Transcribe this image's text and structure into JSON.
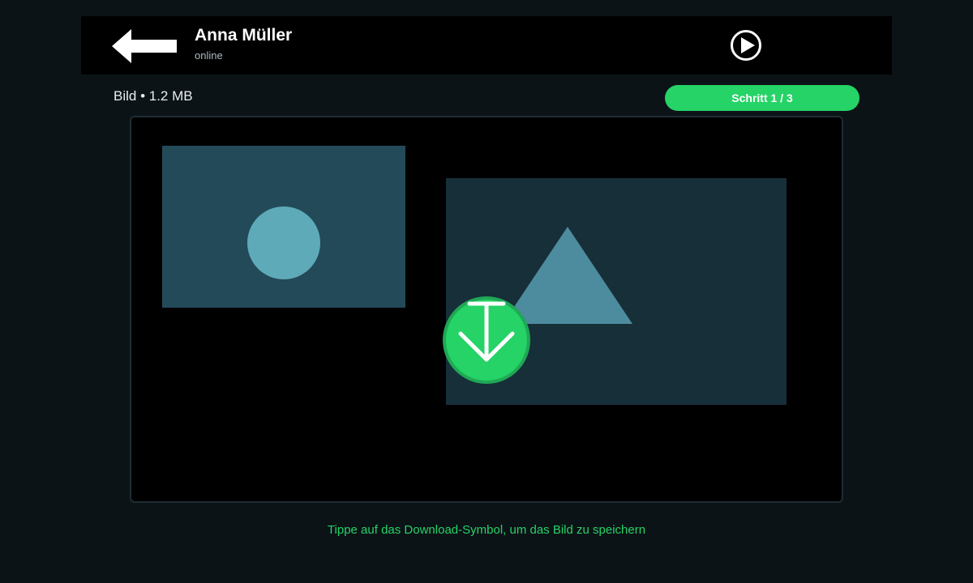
{
  "header": {
    "contact_name": "Anna Müller",
    "contact_status": "online",
    "back_icon": "arrow-left-icon",
    "play_icon": "play-circle-icon"
  },
  "media": {
    "file_info": "Bild • 1.2 MB",
    "step_label": "Schritt 1 / 3",
    "download_icon": "download-icon"
  },
  "hint": "Tippe auf das Download-Symbol, um das Bild zu speichern",
  "colors": {
    "accent": "#25d366",
    "header_bg": "#000000",
    "app_bg": "#0c1317"
  }
}
